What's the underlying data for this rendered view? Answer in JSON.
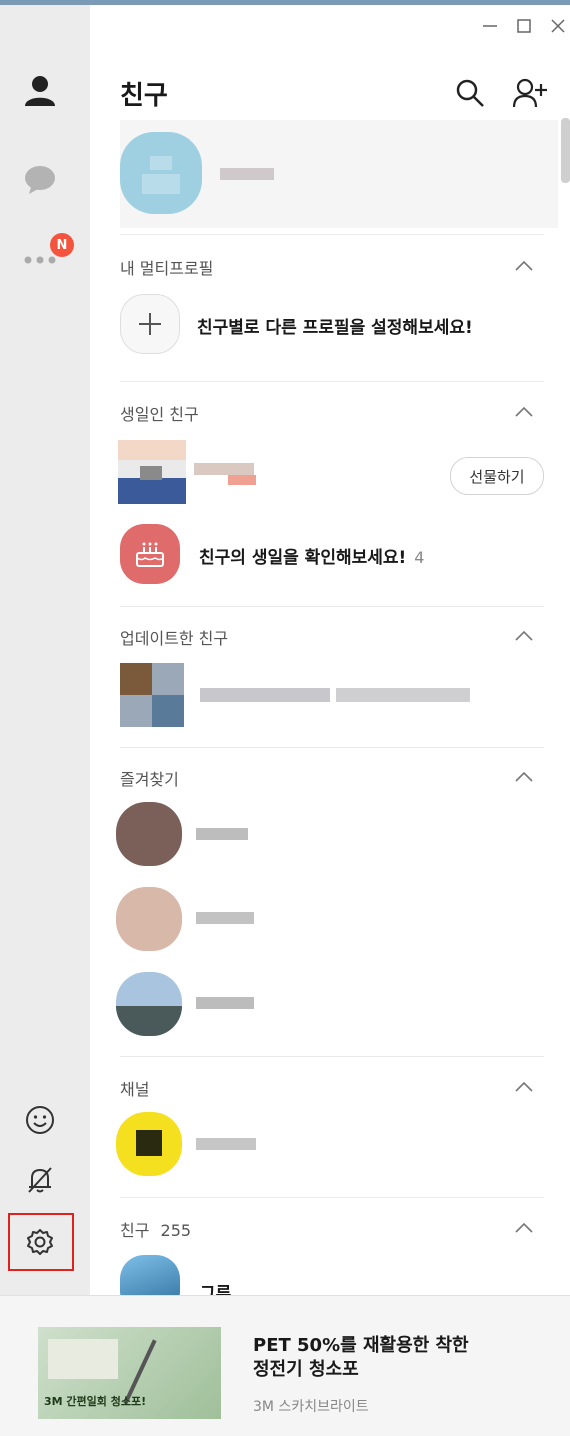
{
  "header": {
    "title": "친구"
  },
  "my_multi_profile": {
    "section_title": "내 멀티프로필",
    "create_text": "친구별로 다른 프로필을 설정해보세요!"
  },
  "birthday": {
    "section_title": "생일인 친구",
    "gift_button": "선물하기",
    "check_text": "친구의 생일을 확인해보세요!",
    "check_count": "4"
  },
  "updated": {
    "section_title": "업데이트한 친구"
  },
  "favorites": {
    "section_title": "즐겨찾기"
  },
  "channel": {
    "section_title": "채널"
  },
  "friends": {
    "section_title": "친구",
    "count": "255",
    "first_name_partial": "그루"
  },
  "sidebar": {
    "notification_badge": "N"
  },
  "ad": {
    "title": "PET 50%를 재활용한 착한\n정전기 청소포",
    "advertiser": "3M 스카치브라이트",
    "image_caption": "3M 간편일회 청소포!"
  },
  "colors": {
    "badge": "#f4543d",
    "highlight_box": "#e0211d",
    "birthday_icon_bg": "#e06b6b"
  }
}
